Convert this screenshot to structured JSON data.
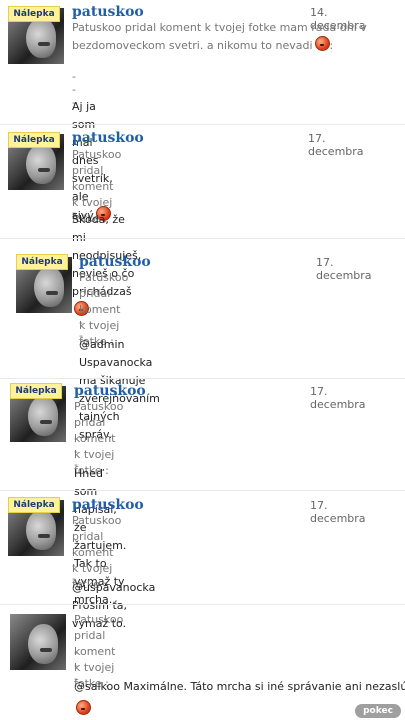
{
  "comments": [
    {
      "sticker": "Nálepka",
      "name": "patuskoo",
      "date": "14. decembra",
      "meta_line1": "Patuskoo pridal koment k tvojej fotke mam rada dni v",
      "meta_line2": "bezdomoveckom svetri. a nikomu to nevadi",
      "meta_line2_suffix": ":",
      "dashes": "- - -",
      "reply": "Aj ja som mal dnes svetrík, ale sivý",
      "reply_smiley": "angry-smiley-icon"
    },
    {
      "sticker": "Nálepka",
      "name": "patuskoo",
      "date": "17. decembra",
      "meta_line1": "Patuskoo pridal koment k tvojej fotke :",
      "dashes": "- - -",
      "reply": "Škoda, že mi neodpisuješ, nevieš o čo prichádzaš",
      "reply_smiley": "angry-smiley-icon"
    },
    {
      "sticker": "Nálepka",
      "name": "patuskoo",
      "date": "17. decembra",
      "meta_line1": "Patuskoo pridal koment k tvojej fotke :",
      "dashes": "- - -",
      "reply_line1": "@admin Uspavanocka ma šikanuje zverejňovaním tajných",
      "reply_line2": "správ."
    },
    {
      "sticker": "Nálepka",
      "name": "patuskoo",
      "date": "17. decembra",
      "meta_line1": "Patuskoo pridal koment k tvojej fotke :",
      "dashes": "- - -",
      "reply": "Hneď som napísal, že žartujem. Tak to vymaž ty mrcha."
    },
    {
      "sticker": "Nálepka",
      "name": "patuskoo",
      "date": "17. decembra",
      "meta_line1": "Patuskoo pridal koment k tvojej fotke :",
      "dashes": "- - -",
      "reply": "@uspavanocka Prosím ťa, vymaž to."
    },
    {
      "meta_line1": "Patuskoo pridal koment k tvojej fotke :",
      "dashes": "- - -",
      "reply": "@salkoo Maximálne. Táto mrcha si iné správanie ani nezaslúži",
      "reply_smiley": "angry-smiley-icon"
    }
  ],
  "watermark": "pokec",
  "colors": {
    "name": "#1f5fa8",
    "sticker_bg": "#fff29a",
    "sticker_text": "#1b3a78"
  }
}
